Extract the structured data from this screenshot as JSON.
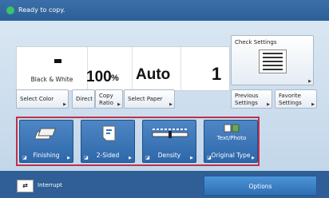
{
  "status": {
    "message": "Ready to copy."
  },
  "copy_settings": {
    "color_mode": "Black & White",
    "ratio_value": "100",
    "ratio_unit": "%",
    "paper": "Auto",
    "copies": "1"
  },
  "buttons": {
    "check_settings": "Check Settings",
    "select_color": "Select Color",
    "direct": "Direct",
    "copy_ratio_1": "Copy",
    "copy_ratio_2": "Ratio",
    "select_paper": "Select Paper",
    "previous_settings_1": "Previous",
    "previous_settings_2": "Settings",
    "favorite_settings_1": "Favorite",
    "favorite_settings_2": "Settings"
  },
  "functions": [
    {
      "label": "Finishing",
      "icon": "finishing-icon"
    },
    {
      "label": "2-Sided",
      "icon": "two-sided-icon"
    },
    {
      "label": "Density",
      "icon": "density-icon"
    },
    {
      "label": "Original Type",
      "icon": "original-type-icon",
      "icon_text": "Text/Photo"
    }
  ],
  "bottom": {
    "interrupt": "Interrupt",
    "options": "Options"
  },
  "colors": {
    "accent_red": "#c0304b",
    "ready_green": "#39c46a",
    "function_blue": "#3a74b5"
  }
}
